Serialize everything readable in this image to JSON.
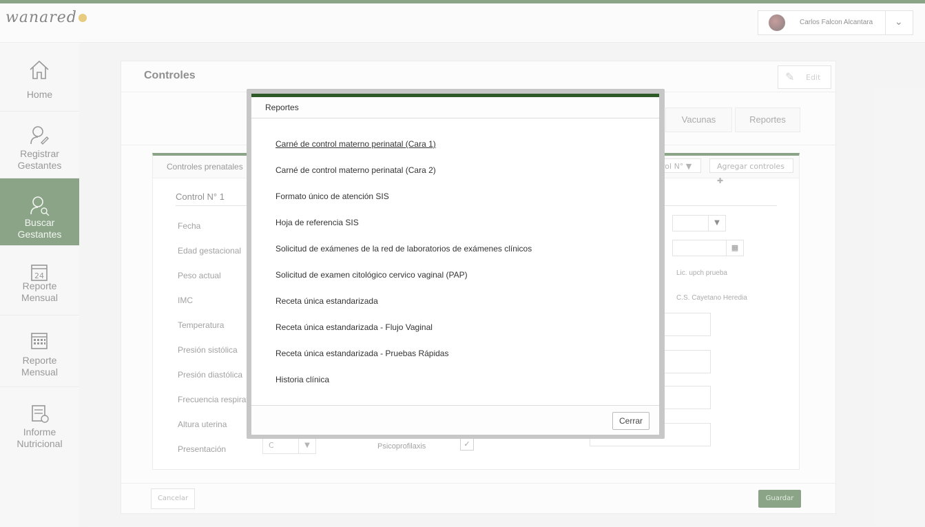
{
  "header": {
    "logo_text": "wanared",
    "user_name": "Carlos Falcon Alcantara",
    "dropdown_icon": "chevron-down-icon"
  },
  "sidebar": {
    "items": [
      {
        "label": "Home",
        "icon": "home-icon",
        "active": false
      },
      {
        "label": "Registrar Gestantes",
        "icon": "user-edit-icon",
        "active": true
      },
      {
        "label": "Buscar Gestantes",
        "icon": "user-search-icon",
        "active": true
      },
      {
        "label": "Reporte Mensual",
        "icon": "calendar-24-icon",
        "active": false
      },
      {
        "label": "Reporte Mensual",
        "icon": "calendar-grid-icon",
        "active": false
      },
      {
        "label": "Informe Nutricional",
        "icon": "report-icon",
        "active": false
      }
    ]
  },
  "panel": {
    "title": "Controles",
    "edit_label": "Edit",
    "tabs": [
      "Vacunas",
      "Reportes"
    ],
    "card": {
      "title": "Controles prenatales",
      "control_select": "rol N°",
      "add_label": "Agregar controles",
      "control_number": "Control N° 1",
      "fields": [
        "Fecha",
        "Edad gestacional",
        "Peso actual",
        "IMC",
        "Temperatura",
        "Presión sistólica",
        "Presión diastólica",
        "Frecuencia respiratoria",
        "Altura uterina",
        "Presentación"
      ],
      "professional": "Lic. upch prueba",
      "establishment": "C.S. Cayetano Heredia",
      "presentacion_value": "C",
      "psico_label": "Psicoprofilaxis",
      "psico_checked": true
    },
    "cancel_label": "Cancelar",
    "save_label": "Guardar"
  },
  "modal": {
    "title": "Reportes",
    "items": [
      "Carné de control materno perinatal (Cara 1)",
      "Carné de control materno perinatal (Cara 2)",
      "Formato único de atención SIS",
      "Hoja de referencia SIS",
      "Solicitud de exámenes de la red de laboratorios de exámenes clínicos",
      "Solicitud de examen citológico cervico vaginal (PAP)",
      "Receta única estandarizada",
      "Receta única estandarizada - Flujo Vaginal",
      "Receta única estandarizada - Pruebas Rápidas",
      "Historia clínica"
    ],
    "close_label": "Cerrar"
  },
  "colors": {
    "brand_green": "#2d5a27",
    "background": "#ececec"
  }
}
